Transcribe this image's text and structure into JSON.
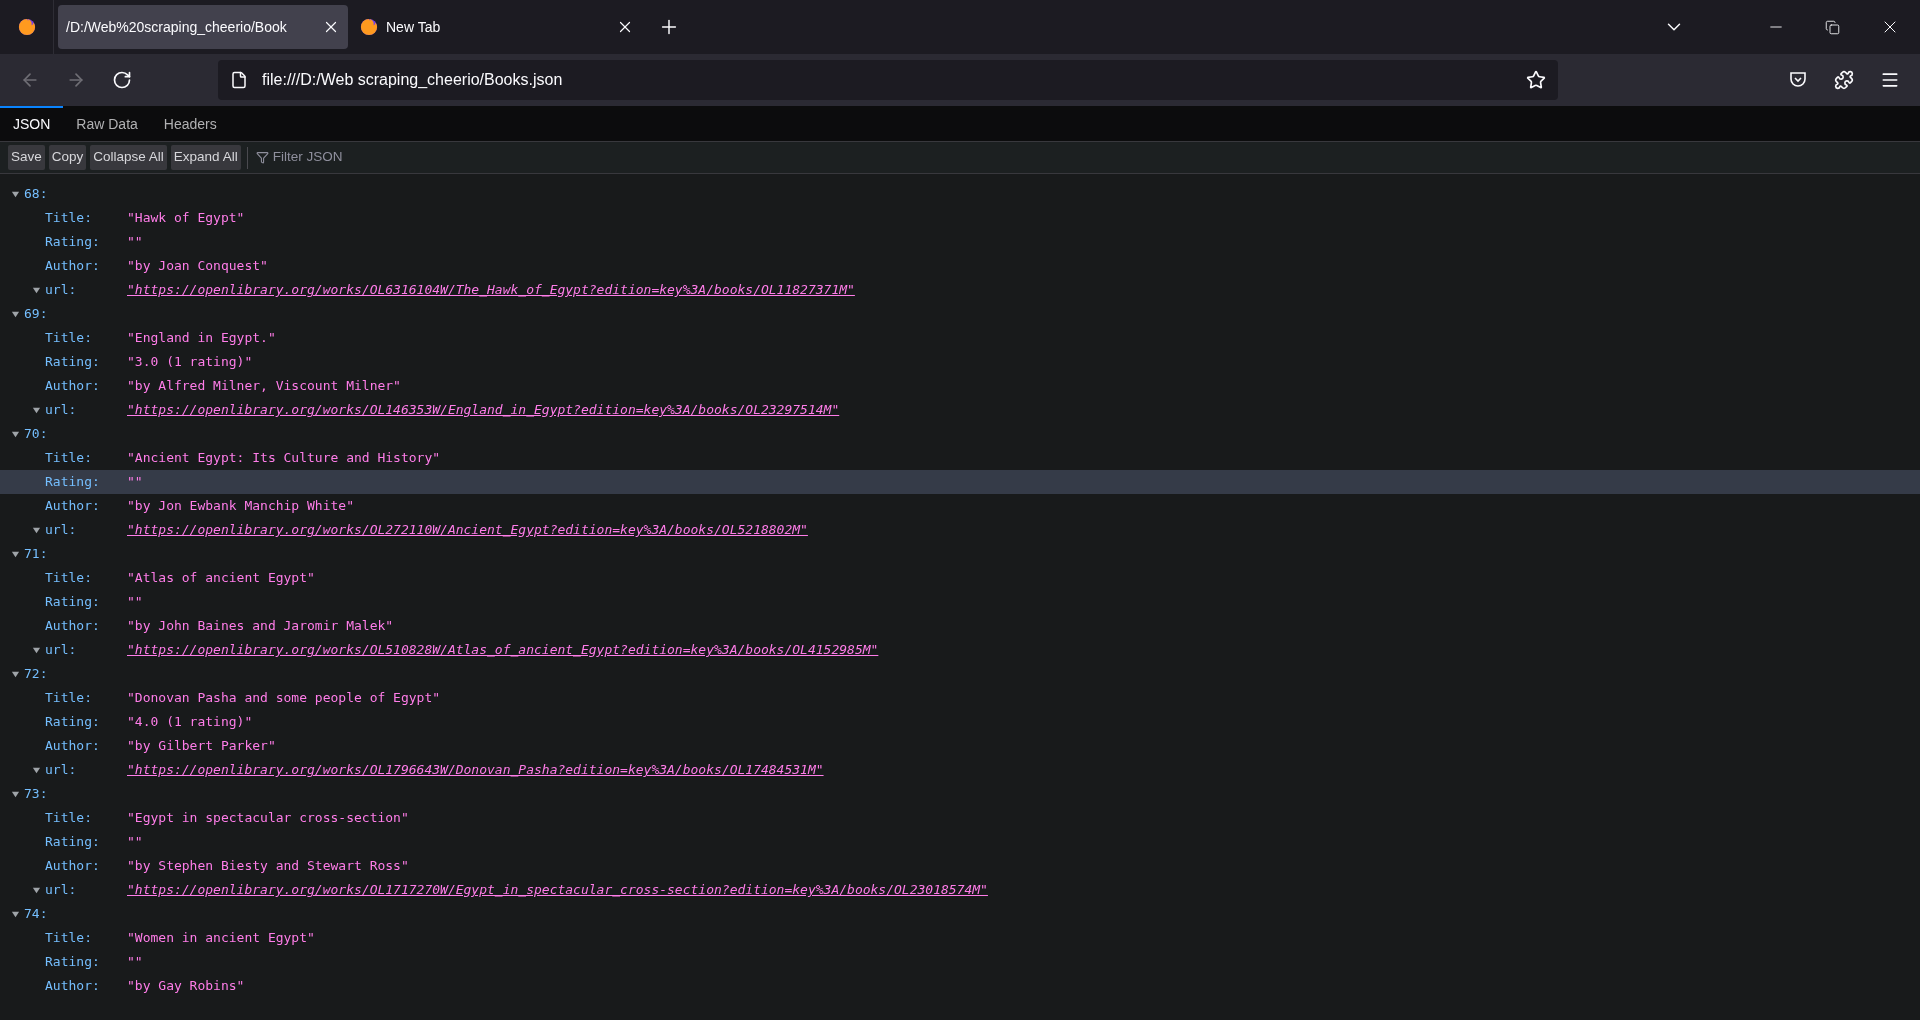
{
  "browser": {
    "tabs": [
      {
        "title": "/D:/Web%20scraping_cheerio/Book",
        "selected": true
      },
      {
        "title": "New Tab",
        "selected": false
      }
    ],
    "address": "file:///D:/Web scraping_cheerio/Books.json"
  },
  "viewer_tabs": [
    {
      "label": "JSON",
      "selected": true
    },
    {
      "label": "Raw Data",
      "selected": false
    },
    {
      "label": "Headers",
      "selected": false
    }
  ],
  "toolbar": {
    "buttons": [
      "Save",
      "Copy",
      "Collapse All",
      "Expand All"
    ],
    "filter_placeholder": "Filter JSON"
  },
  "entries": [
    {
      "index": "68:",
      "expanded": true,
      "fields": [
        {
          "key": "Title:",
          "value": "\"Hawk of Egypt\"",
          "kind": "text",
          "highlighted": false
        },
        {
          "key": "Rating:",
          "value": "\"\"",
          "kind": "text",
          "highlighted": false
        },
        {
          "key": "Author:",
          "value": "\"by Joan Conquest\"",
          "kind": "text",
          "highlighted": false
        },
        {
          "key": "url:",
          "value": "\"https://openlibrary.org/works/OL6316104W/The_Hawk_of_Egypt?edition=key%3A/books/OL11827371M\"",
          "kind": "link",
          "highlighted": false
        }
      ]
    },
    {
      "index": "69:",
      "expanded": true,
      "fields": [
        {
          "key": "Title:",
          "value": "\"England in Egypt.\"",
          "kind": "text",
          "highlighted": false
        },
        {
          "key": "Rating:",
          "value": "\"3.0 (1 rating)\"",
          "kind": "text",
          "highlighted": false
        },
        {
          "key": "Author:",
          "value": "\"by Alfred Milner, Viscount Milner\"",
          "kind": "text",
          "highlighted": false
        },
        {
          "key": "url:",
          "value": "\"https://openlibrary.org/works/OL146353W/England_in_Egypt?edition=key%3A/books/OL23297514M\"",
          "kind": "link",
          "highlighted": false
        }
      ]
    },
    {
      "index": "70:",
      "expanded": true,
      "fields": [
        {
          "key": "Title:",
          "value": "\"Ancient Egypt: Its Culture and History\"",
          "kind": "text",
          "highlighted": false
        },
        {
          "key": "Rating:",
          "value": "\"\"",
          "kind": "text",
          "highlighted": true
        },
        {
          "key": "Author:",
          "value": "\"by Jon Ewbank Manchip White\"",
          "kind": "text",
          "highlighted": false
        },
        {
          "key": "url:",
          "value": "\"https://openlibrary.org/works/OL272110W/Ancient_Egypt?edition=key%3A/books/OL5218802M\"",
          "kind": "link",
          "highlighted": false
        }
      ]
    },
    {
      "index": "71:",
      "expanded": true,
      "fields": [
        {
          "key": "Title:",
          "value": "\"Atlas of ancient Egypt\"",
          "kind": "text",
          "highlighted": false
        },
        {
          "key": "Rating:",
          "value": "\"\"",
          "kind": "text",
          "highlighted": false
        },
        {
          "key": "Author:",
          "value": "\"by John Baines and Jaromir Malek\"",
          "kind": "text",
          "highlighted": false
        },
        {
          "key": "url:",
          "value": "\"https://openlibrary.org/works/OL510828W/Atlas_of_ancient_Egypt?edition=key%3A/books/OL4152985M\"",
          "kind": "link",
          "highlighted": false
        }
      ]
    },
    {
      "index": "72:",
      "expanded": true,
      "fields": [
        {
          "key": "Title:",
          "value": "\"Donovan Pasha and some people of Egypt\"",
          "kind": "text",
          "highlighted": false
        },
        {
          "key": "Rating:",
          "value": "\"4.0 (1 rating)\"",
          "kind": "text",
          "highlighted": false
        },
        {
          "key": "Author:",
          "value": "\"by Gilbert Parker\"",
          "kind": "text",
          "highlighted": false
        },
        {
          "key": "url:",
          "value": "\"https://openlibrary.org/works/OL1796643W/Donovan_Pasha?edition=key%3A/books/OL17484531M\"",
          "kind": "link",
          "highlighted": false
        }
      ]
    },
    {
      "index": "73:",
      "expanded": true,
      "fields": [
        {
          "key": "Title:",
          "value": "\"Egypt in spectacular cross-section\"",
          "kind": "text",
          "highlighted": false
        },
        {
          "key": "Rating:",
          "value": "\"\"",
          "kind": "text",
          "highlighted": false
        },
        {
          "key": "Author:",
          "value": "\"by Stephen Biesty and Stewart Ross\"",
          "kind": "text",
          "highlighted": false
        },
        {
          "key": "url:",
          "value": "\"https://openlibrary.org/works/OL1717270W/Egypt_in_spectacular_cross-section?edition=key%3A/books/OL23018574M\"",
          "kind": "link",
          "highlighted": false
        }
      ]
    },
    {
      "index": "74:",
      "expanded": true,
      "fields": [
        {
          "key": "Title:",
          "value": "\"Women in ancient Egypt\"",
          "kind": "text",
          "highlighted": false
        },
        {
          "key": "Rating:",
          "value": "\"\"",
          "kind": "text",
          "highlighted": false
        },
        {
          "key": "Author:",
          "value": "\"by Gay Robins\"",
          "kind": "text",
          "highlighted": false
        }
      ]
    }
  ]
}
